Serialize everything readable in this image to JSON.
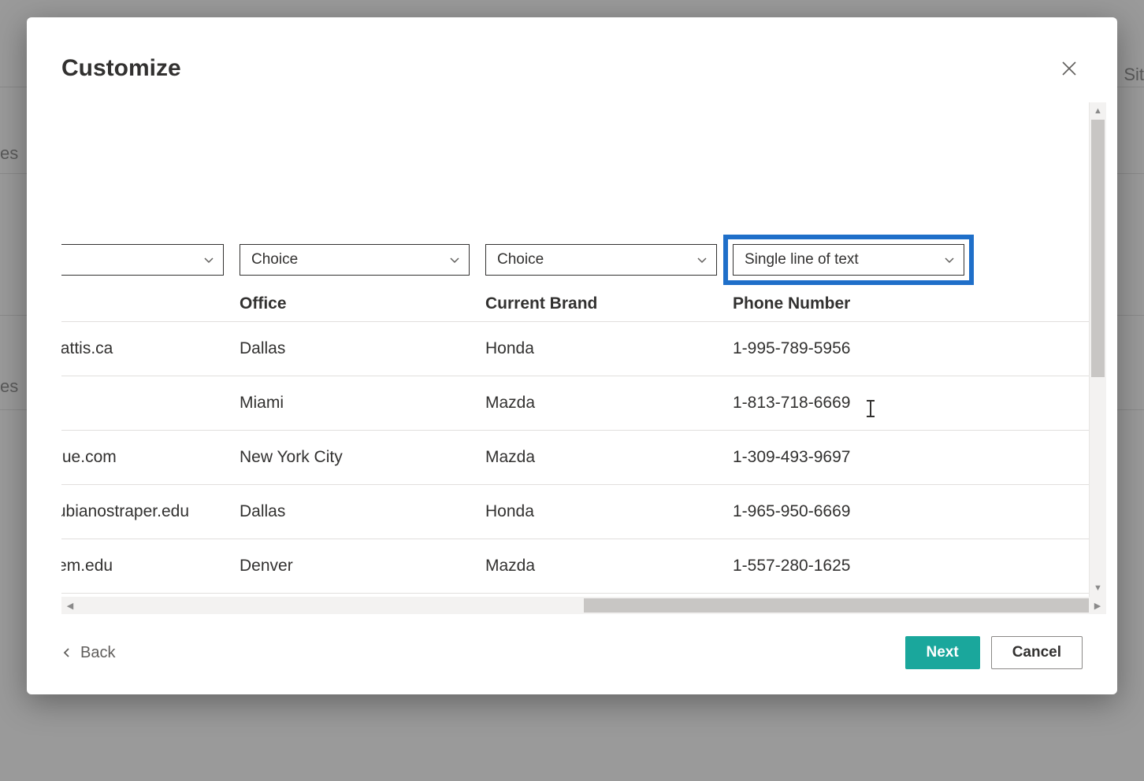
{
  "background": {
    "sit": "Sit",
    "es1": "es",
    "es2": "es"
  },
  "modal": {
    "title": "Customize",
    "selectors": [
      {
        "label": "",
        "blank": true
      },
      {
        "label": "Choice"
      },
      {
        "label": "Choice"
      },
      {
        "label": "Single line of text",
        "highlighted": true
      }
    ],
    "columns": [
      "",
      "Office",
      "Current Brand",
      "Phone Number"
    ],
    "rows": [
      {
        "c0": "@mattis.ca",
        "c1": "Dallas",
        "c2": "Honda",
        "c3": "1-995-789-5956"
      },
      {
        "c0": "",
        "c1": "Miami",
        "c2": "Mazda",
        "c3": "1-813-718-6669"
      },
      {
        "c0": "atoque.com",
        "c1": "New York City",
        "c2": "Mazda",
        "c3": "1-309-493-9697"
      },
      {
        "c0": "conubianostraper.edu",
        "c1": "Dallas",
        "c2": "Honda",
        "c3": "1-965-950-6669"
      },
      {
        "c0": "nlorem.edu",
        "c1": "Denver",
        "c2": "Mazda",
        "c3": "1-557-280-1625"
      }
    ],
    "footer": {
      "back": "Back",
      "next": "Next",
      "cancel": "Cancel"
    }
  }
}
